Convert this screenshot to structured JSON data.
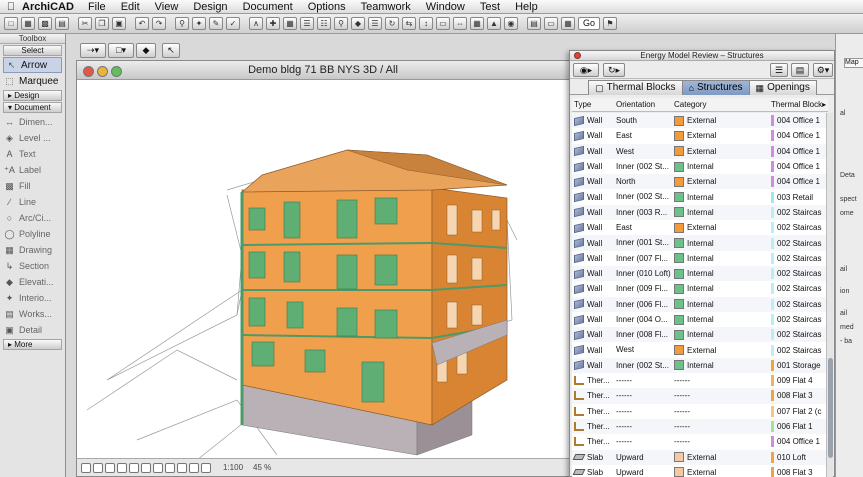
{
  "menubar": {
    "app": "ArchiCAD",
    "items": [
      "File",
      "Edit",
      "View",
      "Design",
      "Document",
      "Options",
      "Teamwork",
      "Window",
      "Test",
      "Help"
    ]
  },
  "toolbar": {
    "go_label": "Go"
  },
  "toolbox": {
    "title": "Toolbox",
    "select_label": "Select",
    "arrow_label": "Arrow",
    "marquee_label": "Marquee",
    "design_label": "Design",
    "document_label": "Document",
    "tools": [
      "Dimen...",
      "Level ...",
      "Text",
      "Label",
      "Fill",
      "Line",
      "Arc/Ci...",
      "Polyline",
      "Drawing",
      "Section",
      "Elevati...",
      "Interio...",
      "Works...",
      "Detail"
    ],
    "more_label": "More"
  },
  "window": {
    "title": "Demo bldg 71 BB NYS 3D / All",
    "scale": "1:100",
    "zoom": "45 %"
  },
  "panel": {
    "title": "Energy Model Review – Structures",
    "tabs": [
      "Thermal Blocks",
      "Structures",
      "Openings"
    ],
    "columns": [
      "Type",
      "Orientation",
      "Category",
      "Thermal Block"
    ],
    "rows": [
      {
        "type": "Wall",
        "orientation": "South",
        "category": "External",
        "block": "004 Office 1",
        "cat_color": "#f39a3c",
        "block_color": "#cf8be0"
      },
      {
        "type": "Wall",
        "orientation": "East",
        "category": "External",
        "block": "004 Office 1",
        "cat_color": "#f39a3c",
        "block_color": "#cf8be0"
      },
      {
        "type": "Wall",
        "orientation": "West",
        "category": "External",
        "block": "004 Office 1",
        "cat_color": "#f39a3c",
        "block_color": "#cf8be0"
      },
      {
        "type": "Wall",
        "orientation": "Inner (002 St...",
        "category": "Internal",
        "block": "004 Office 1",
        "cat_color": "#6cc08a",
        "block_color": "#cf8be0"
      },
      {
        "type": "Wall",
        "orientation": "North",
        "category": "External",
        "block": "004 Office 1",
        "cat_color": "#f39a3c",
        "block_color": "#cf8be0"
      },
      {
        "type": "Wall",
        "orientation": "Inner (002 St...",
        "category": "Internal",
        "block": "003 Retail",
        "cat_color": "#6cc08a",
        "block_color": "#9fe6ef"
      },
      {
        "type": "Wall",
        "orientation": "Inner (003 R...",
        "category": "Internal",
        "block": "002 Staircas",
        "cat_color": "#6cc08a",
        "block_color": "#b9eef4"
      },
      {
        "type": "Wall",
        "orientation": "East",
        "category": "External",
        "block": "002 Staircas",
        "cat_color": "#f39a3c",
        "block_color": "#b9eef4"
      },
      {
        "type": "Wall",
        "orientation": "Inner (001 St...",
        "category": "Internal",
        "block": "002 Staircas",
        "cat_color": "#6cc08a",
        "block_color": "#b9eef4"
      },
      {
        "type": "Wall",
        "orientation": "Inner (007 Fl...",
        "category": "Internal",
        "block": "002 Staircas",
        "cat_color": "#6cc08a",
        "block_color": "#b9eef4"
      },
      {
        "type": "Wall",
        "orientation": "Inner (010 Loft)",
        "category": "Internal",
        "block": "002 Staircas",
        "cat_color": "#6cc08a",
        "block_color": "#b9eef4"
      },
      {
        "type": "Wall",
        "orientation": "Inner (009 Fl...",
        "category": "Internal",
        "block": "002 Staircas",
        "cat_color": "#6cc08a",
        "block_color": "#b9eef4"
      },
      {
        "type": "Wall",
        "orientation": "Inner (006 Fl...",
        "category": "Internal",
        "block": "002 Staircas",
        "cat_color": "#6cc08a",
        "block_color": "#b9eef4"
      },
      {
        "type": "Wall",
        "orientation": "Inner (004 O...",
        "category": "Internal",
        "block": "002 Staircas",
        "cat_color": "#6cc08a",
        "block_color": "#b9eef4"
      },
      {
        "type": "Wall",
        "orientation": "Inner (008 Fl...",
        "category": "Internal",
        "block": "002 Staircas",
        "cat_color": "#6cc08a",
        "block_color": "#b9eef4"
      },
      {
        "type": "Wall",
        "orientation": "West",
        "category": "External",
        "block": "002 Staircas",
        "cat_color": "#f39a3c",
        "block_color": "#b9eef4"
      },
      {
        "type": "Wall",
        "orientation": "Inner (002 St...",
        "category": "Internal",
        "block": "001 Storage",
        "cat_color": "#6cc08a",
        "block_color": "#f0a53c"
      },
      {
        "type": "Ther...",
        "orientation": "------",
        "category": "------",
        "block": "009 Flat 4",
        "cat_color": "",
        "block_color": "#f3b35c"
      },
      {
        "type": "Ther...",
        "orientation": "------",
        "category": "------",
        "block": "008 Flat 3",
        "cat_color": "",
        "block_color": "#f0a53c"
      },
      {
        "type": "Ther...",
        "orientation": "------",
        "category": "------",
        "block": "007 Flat 2 (c",
        "cat_color": "",
        "block_color": "#f6c67a"
      },
      {
        "type": "Ther...",
        "orientation": "------",
        "category": "------",
        "block": "006 Flat 1",
        "cat_color": "",
        "block_color": "#a6e38e"
      },
      {
        "type": "Ther...",
        "orientation": "------",
        "category": "------",
        "block": "004 Office 1",
        "cat_color": "",
        "block_color": "#cf8be0"
      },
      {
        "type": "Slab",
        "orientation": "Upward",
        "category": "External",
        "block": "010 Loft",
        "cat_color": "#f5c9a2",
        "block_color": "#f0a53c"
      },
      {
        "type": "Slab",
        "orientation": "Upward",
        "category": "External",
        "block": "008 Flat 3",
        "cat_color": "#f5c9a2",
        "block_color": "#f0a53c"
      }
    ]
  },
  "right_panel": {
    "lines": [
      "Map",
      "al",
      "Deta",
      "spect",
      "ome",
      "ail",
      "ion",
      "ail",
      "med",
      "- ba"
    ]
  }
}
